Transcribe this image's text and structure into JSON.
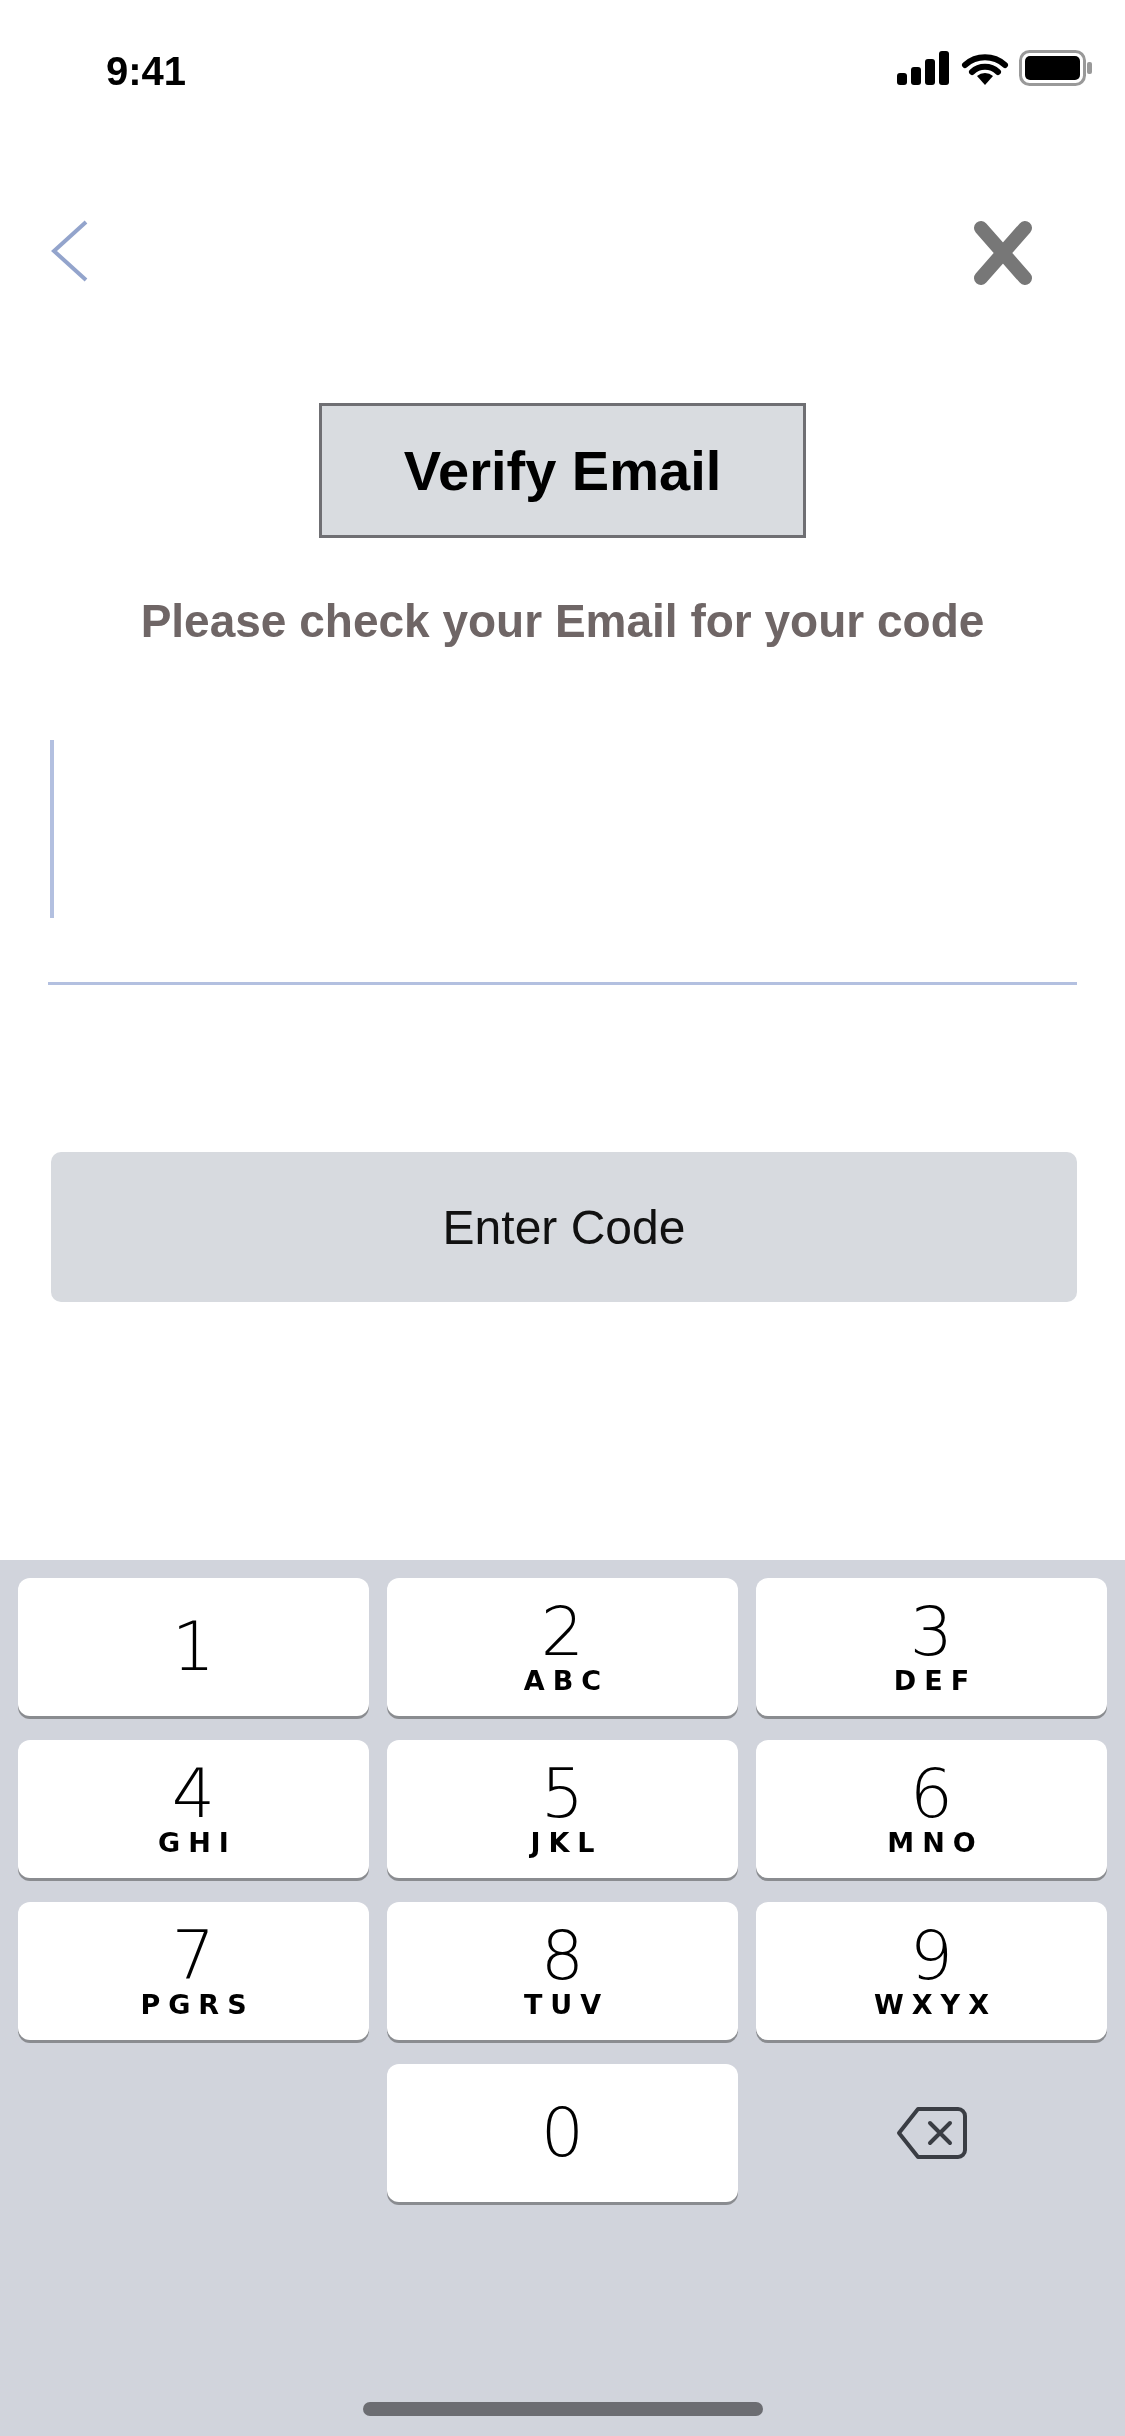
{
  "status_bar": {
    "time": "9:41"
  },
  "header": {
    "title": "Verify Email",
    "subtitle": "Please check your Email for your code"
  },
  "code_field": {
    "focused": true
  },
  "submit_button": {
    "label": "Enter Code"
  },
  "keypad": [
    {
      "kind": "digit",
      "digit": "1"
    },
    {
      "kind": "digit",
      "digit": "2",
      "letters": "ABC"
    },
    {
      "kind": "digit",
      "digit": "3",
      "letters": "DEF"
    },
    {
      "kind": "digit",
      "digit": "4",
      "letters": "GHI"
    },
    {
      "kind": "digit",
      "digit": "5",
      "letters": "JKL"
    },
    {
      "kind": "digit",
      "digit": "6",
      "letters": "MNO"
    },
    {
      "kind": "digit",
      "digit": "7",
      "letters": "PGRS"
    },
    {
      "kind": "digit",
      "digit": "8",
      "letters": "TUV"
    },
    {
      "kind": "digit",
      "digit": "9",
      "letters": "WXYX"
    },
    {
      "kind": "digit",
      "digit": "0"
    },
    {
      "kind": "backspace"
    }
  ]
}
